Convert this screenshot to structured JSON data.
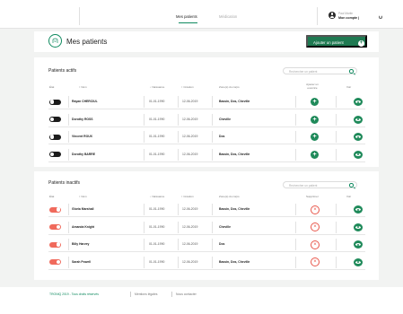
{
  "nav": {
    "links": [
      {
        "label": "Mes patients",
        "active": true
      },
      {
        "label": "Médication",
        "active": false
      }
    ],
    "account": {
      "name": "Paul Martin",
      "link": "Mon compte |"
    }
  },
  "titlebar": {
    "title": "Mes patients",
    "add_button": "Ajouter un patient",
    "add_icon": "+"
  },
  "active": {
    "title": "Patients actifs",
    "search_placeholder": "Rechercher un patient",
    "headers": {
      "state": "État",
      "name": "↕ Nom",
      "birth": "↓ Naissance",
      "created": "↕ Création",
      "areas": "Zone(s) du corps",
      "action": "Ajouter un exercice",
      "view": "Voir"
    },
    "rows": [
      {
        "name": "Rayan CHERCIUL",
        "birth": "01-01-1990",
        "created": "12-06-2019",
        "areas": "Bassin, Dos, Cheville"
      },
      {
        "name": "Dorothy ROSS",
        "birth": "01-01-1990",
        "created": "12-06-2019",
        "areas": "Cheville"
      },
      {
        "name": "Vincent ROUX",
        "birth": "01-01-1990",
        "created": "12-06-2019",
        "areas": "Dos"
      },
      {
        "name": "Dorothy BARRE",
        "birth": "01-01-1990",
        "created": "12-06-2019",
        "areas": "Bassin, Dos, Cheville"
      }
    ]
  },
  "inactive": {
    "title": "Patients inactifs",
    "search_placeholder": "Rechercher un patient",
    "headers": {
      "state": "État",
      "name": "↕ Nom",
      "birth": "↓ Naissance",
      "created": "↕ Création",
      "areas": "Zone(s) du corps",
      "action": "Supprimer",
      "view": "Voir"
    },
    "rows": [
      {
        "name": "Gloria Marshall",
        "birth": "01-01-1990",
        "created": "12-06-2019",
        "areas": "Bassin, Dos, Cheville"
      },
      {
        "name": "Amanda Knight",
        "birth": "01-01-1990",
        "created": "12-06-2019",
        "areas": "Cheville"
      },
      {
        "name": "Billy Harvey",
        "birth": "01-01-1990",
        "created": "12-06-2019",
        "areas": "Dos"
      },
      {
        "name": "Sarah Powell",
        "birth": "01-01-1990",
        "created": "12-06-2019",
        "areas": "Bassin, Dos, Cheville"
      }
    ]
  },
  "footer": {
    "copyright": "TRONIQ 2019 - Tous droits réservés",
    "legal": "Mentions légales",
    "contact": "Nous contacter"
  },
  "colors": {
    "accent": "#1f7a52",
    "danger": "#e8564a"
  }
}
